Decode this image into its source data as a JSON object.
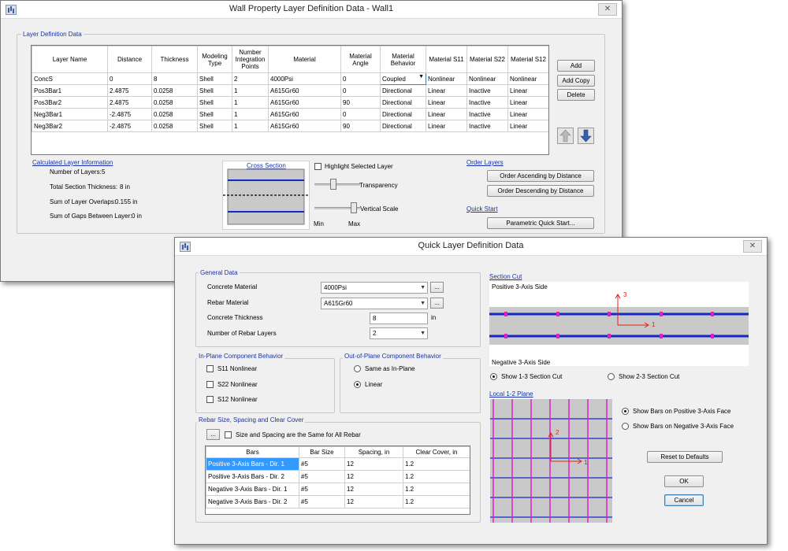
{
  "wall": {
    "title": "Wall Property Layer Definition Data - Wall1",
    "close_label": "✕",
    "layer_group_label": "Layer Definition Data",
    "columns": [
      "Layer Name",
      "Distance",
      "Thickness",
      "Modeling Type",
      "Number Integration Points",
      "Material",
      "Material Angle",
      "Material Behavior",
      "Material S11",
      "Material S22",
      "Material S12"
    ],
    "rows": [
      [
        "ConcS",
        "0",
        "8",
        "Shell",
        "2",
        "4000Psi",
        "0",
        "Coupled",
        "Nonlinear",
        "Nonlinear",
        "Nonlinear"
      ],
      [
        "Pos3Bar1",
        "2.4875",
        "0.0258",
        "Shell",
        "1",
        "A615Gr60",
        "0",
        "Directional",
        "Linear",
        "Inactive",
        "Linear"
      ],
      [
        "Pos3Bar2",
        "2.4875",
        "0.0258",
        "Shell",
        "1",
        "A615Gr60",
        "90",
        "Directional",
        "Linear",
        "Inactive",
        "Linear"
      ],
      [
        "Neg3Bar1",
        "-2.4875",
        "0.0258",
        "Shell",
        "1",
        "A615Gr60",
        "0",
        "Directional",
        "Linear",
        "Inactive",
        "Linear"
      ],
      [
        "Neg3Bar2",
        "-2.4875",
        "0.0258",
        "Shell",
        "1",
        "A615Gr60",
        "90",
        "Directional",
        "Linear",
        "Inactive",
        "Linear"
      ]
    ],
    "buttons": {
      "add": "Add",
      "add_copy": "Add Copy",
      "delete": "Delete"
    },
    "calc": {
      "label": "Calculated Layer Information",
      "num_layers_label": "Number of Layers:",
      "num_layers": "5",
      "thickness_label": "Total Section Thickness:",
      "thickness": "8 in",
      "overlaps_label": "Sum of Layer Overlaps:",
      "overlaps": "0.155 in",
      "gaps_label": "Sum of Gaps Between Layer:",
      "gaps": "0 in"
    },
    "cross_section_label": "Cross Section",
    "highlight_label": "Highlight Selected Layer",
    "transparency_label": "Transparency",
    "vertical_scale_label": "Vertical Scale",
    "min_label": "Min",
    "max_label": "Max",
    "transparency_level": 0.4,
    "vertical_scale_level": 0.85,
    "order_layers_label": "Order Layers",
    "order_asc": "Order Ascending by Distance",
    "order_desc": "Order Descending by Distance",
    "quick_start_label": "Quick Start",
    "parametric": "Parametric Quick Start..."
  },
  "quick": {
    "title": "Quick Layer Definition Data",
    "close_label": "✕",
    "general_label": "General Data",
    "concrete_material_label": "Concrete Material",
    "concrete_material": "4000Psi",
    "rebar_material_label": "Rebar Material",
    "rebar_material": "A615Gr60",
    "concrete_thickness_label": "Concrete Thickness",
    "concrete_thickness": "8",
    "thickness_unit": "in",
    "num_rebar_layers_label": "Number of Rebar Layers",
    "num_rebar_layers": "2",
    "inplane_label": "In-Plane Component Behavior",
    "s11": "S11 Nonlinear",
    "s22": "S22 Nonlinear",
    "s12": "S12 Nonlinear",
    "outplane_label": "Out-of-Plane Component Behavior",
    "same_inplane": "Same as In-Plane",
    "linear": "Linear",
    "rebar_label": "Rebar Size, Spacing and Clear Cover",
    "same_all": "Size and Spacing are the Same for All Rebar",
    "ellipsis": "...",
    "bar_columns": [
      "Bars",
      "Bar Size",
      "Spacing, in",
      "Clear Cover, in"
    ],
    "bar_rows": [
      [
        "Positive 3-Axis Bars - Dir. 1",
        "#5",
        "12",
        "1.2"
      ],
      [
        "Positive 3-Axis Bars - Dir. 2",
        "#5",
        "12",
        "1.2"
      ],
      [
        "Negative 3-Axis Bars - Dir. 1",
        "#5",
        "12",
        "1.2"
      ],
      [
        "Negative 3-Axis Bars - Dir. 2",
        "#5",
        "12",
        "1.2"
      ]
    ],
    "section_cut_label": "Section Cut",
    "positive_side": "Positive 3-Axis Side",
    "negative_side": "Negative 3-Axis Side",
    "axis3": "3",
    "axis1": "1",
    "axis2": "2",
    "show13": "Show 1-3 Section Cut",
    "show23": "Show 2-3 Section Cut",
    "local_plane_label": "Local 1-2 Plane",
    "show_pos_face": "Show Bars on Positive 3-Axis Face",
    "show_neg_face": "Show Bars on Negative 3-Axis Face",
    "reset": "Reset to Defaults",
    "ok": "OK",
    "cancel": "Cancel"
  },
  "colors": {
    "accent": "#1a33a8",
    "rebar": "#1428c8",
    "bar_dot": "#e020c8",
    "selection": "#3399ff"
  }
}
